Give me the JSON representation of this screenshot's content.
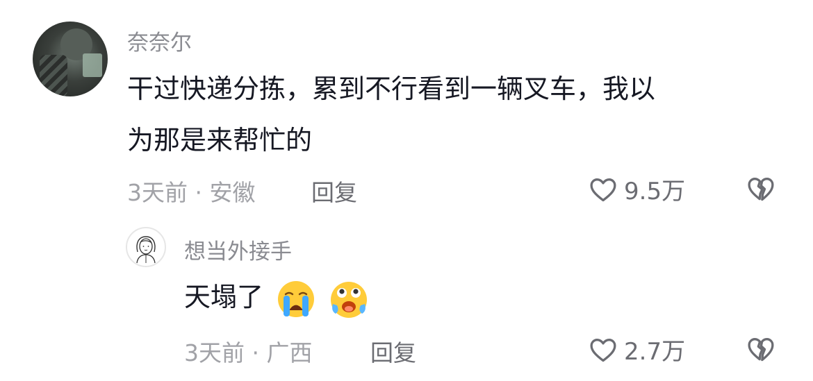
{
  "comments": [
    {
      "username": "奈奈尔",
      "text_line1": "干过快递分拣，累到不行看到一辆叉车，我以",
      "text_line2": "为那是来帮忙的",
      "meta": "3天前 · 安徽",
      "reply_label": "回复",
      "likes": "9.5万",
      "avatar_icon": "user-avatar-photo"
    },
    {
      "username": "想当外接手",
      "text": "天塌了",
      "emojis": [
        "crying-face-emoji",
        "pleading-face-emoji"
      ],
      "meta": "3天前 · 广西",
      "reply_label": "回复",
      "likes": "2.7万",
      "avatar_icon": "line-drawn-girl-avatar"
    }
  ],
  "colors": {
    "text": "#161823",
    "username": "#8a8b91",
    "meta": "#a1a2a7",
    "action": "#6b6c72"
  }
}
